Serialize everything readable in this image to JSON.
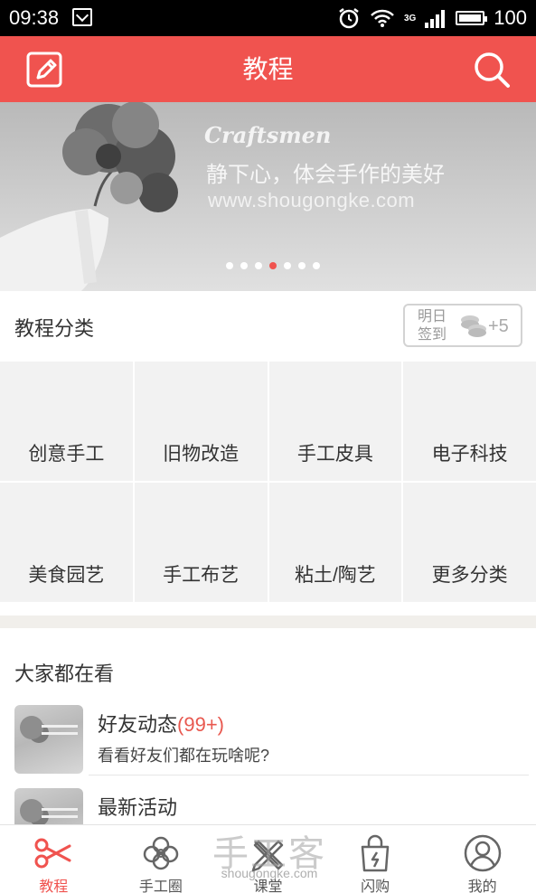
{
  "status_bar": {
    "time": "09:38",
    "network": "3G",
    "battery": "100"
  },
  "app_bar": {
    "title": "教程",
    "edit_icon": "edit-icon",
    "search_icon": "search-icon"
  },
  "banner": {
    "brand": "Craftsmen",
    "slogan": "静下心，体会手作的美好",
    "url": "www.shougongke.com",
    "dot_count": 7,
    "active_dot": 3
  },
  "categories": {
    "title": "教程分类",
    "checkin": {
      "label": "明日签到",
      "bonus": "+5"
    },
    "items": [
      "创意手工",
      "旧物改造",
      "手工皮具",
      "电子科技",
      "美食园艺",
      "手工布艺",
      "粘土/陶艺",
      "更多分类"
    ]
  },
  "hot": {
    "title": "大家都在看",
    "items": [
      {
        "name": "好友动态",
        "count": "(99+)",
        "desc": "看看好友们都在玩啥呢?"
      },
      {
        "name": "最新活动",
        "count": "",
        "desc": ""
      }
    ]
  },
  "bottom_nav": {
    "items": [
      {
        "label": "教程",
        "icon": "scissors-icon",
        "active": true
      },
      {
        "label": "手工圈",
        "icon": "flower-icon",
        "active": false
      },
      {
        "label": "课堂",
        "icon": "pencil-ruler-icon",
        "active": false
      },
      {
        "label": "闪购",
        "icon": "shopping-bag-icon",
        "active": false
      },
      {
        "label": "我的",
        "icon": "user-icon",
        "active": false
      }
    ]
  },
  "watermark": {
    "text": "手工客",
    "url": "shougongke.com"
  },
  "colors": {
    "accent": "#f0534f",
    "grid_bg": "#f2f2f2",
    "banner_bg": "#cfcfcf"
  }
}
